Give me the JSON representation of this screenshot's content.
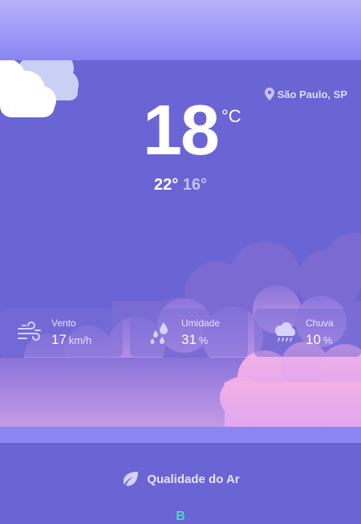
{
  "location": {
    "name": "São Paulo, SP",
    "icon": "location-pin-icon"
  },
  "current": {
    "temperature": "18",
    "unit": "°C",
    "max": "22°",
    "min": "16°"
  },
  "metrics": [
    {
      "label": "Vento",
      "value": "17",
      "unit": "km/h",
      "icon": "wind-icon"
    },
    {
      "label": "Umidade",
      "value": "31",
      "unit": "%",
      "icon": "humidity-icon"
    },
    {
      "label": "Chuva",
      "value": "10",
      "unit": "%",
      "icon": "rain-cloud-icon"
    }
  ],
  "air_quality": {
    "title": "Qualidade do Ar",
    "status": "B",
    "icon": "leaf-icon"
  },
  "colors": {
    "background": "#6a64d4",
    "accent": "#4cd9c4",
    "top_band": "#8a84f2"
  }
}
